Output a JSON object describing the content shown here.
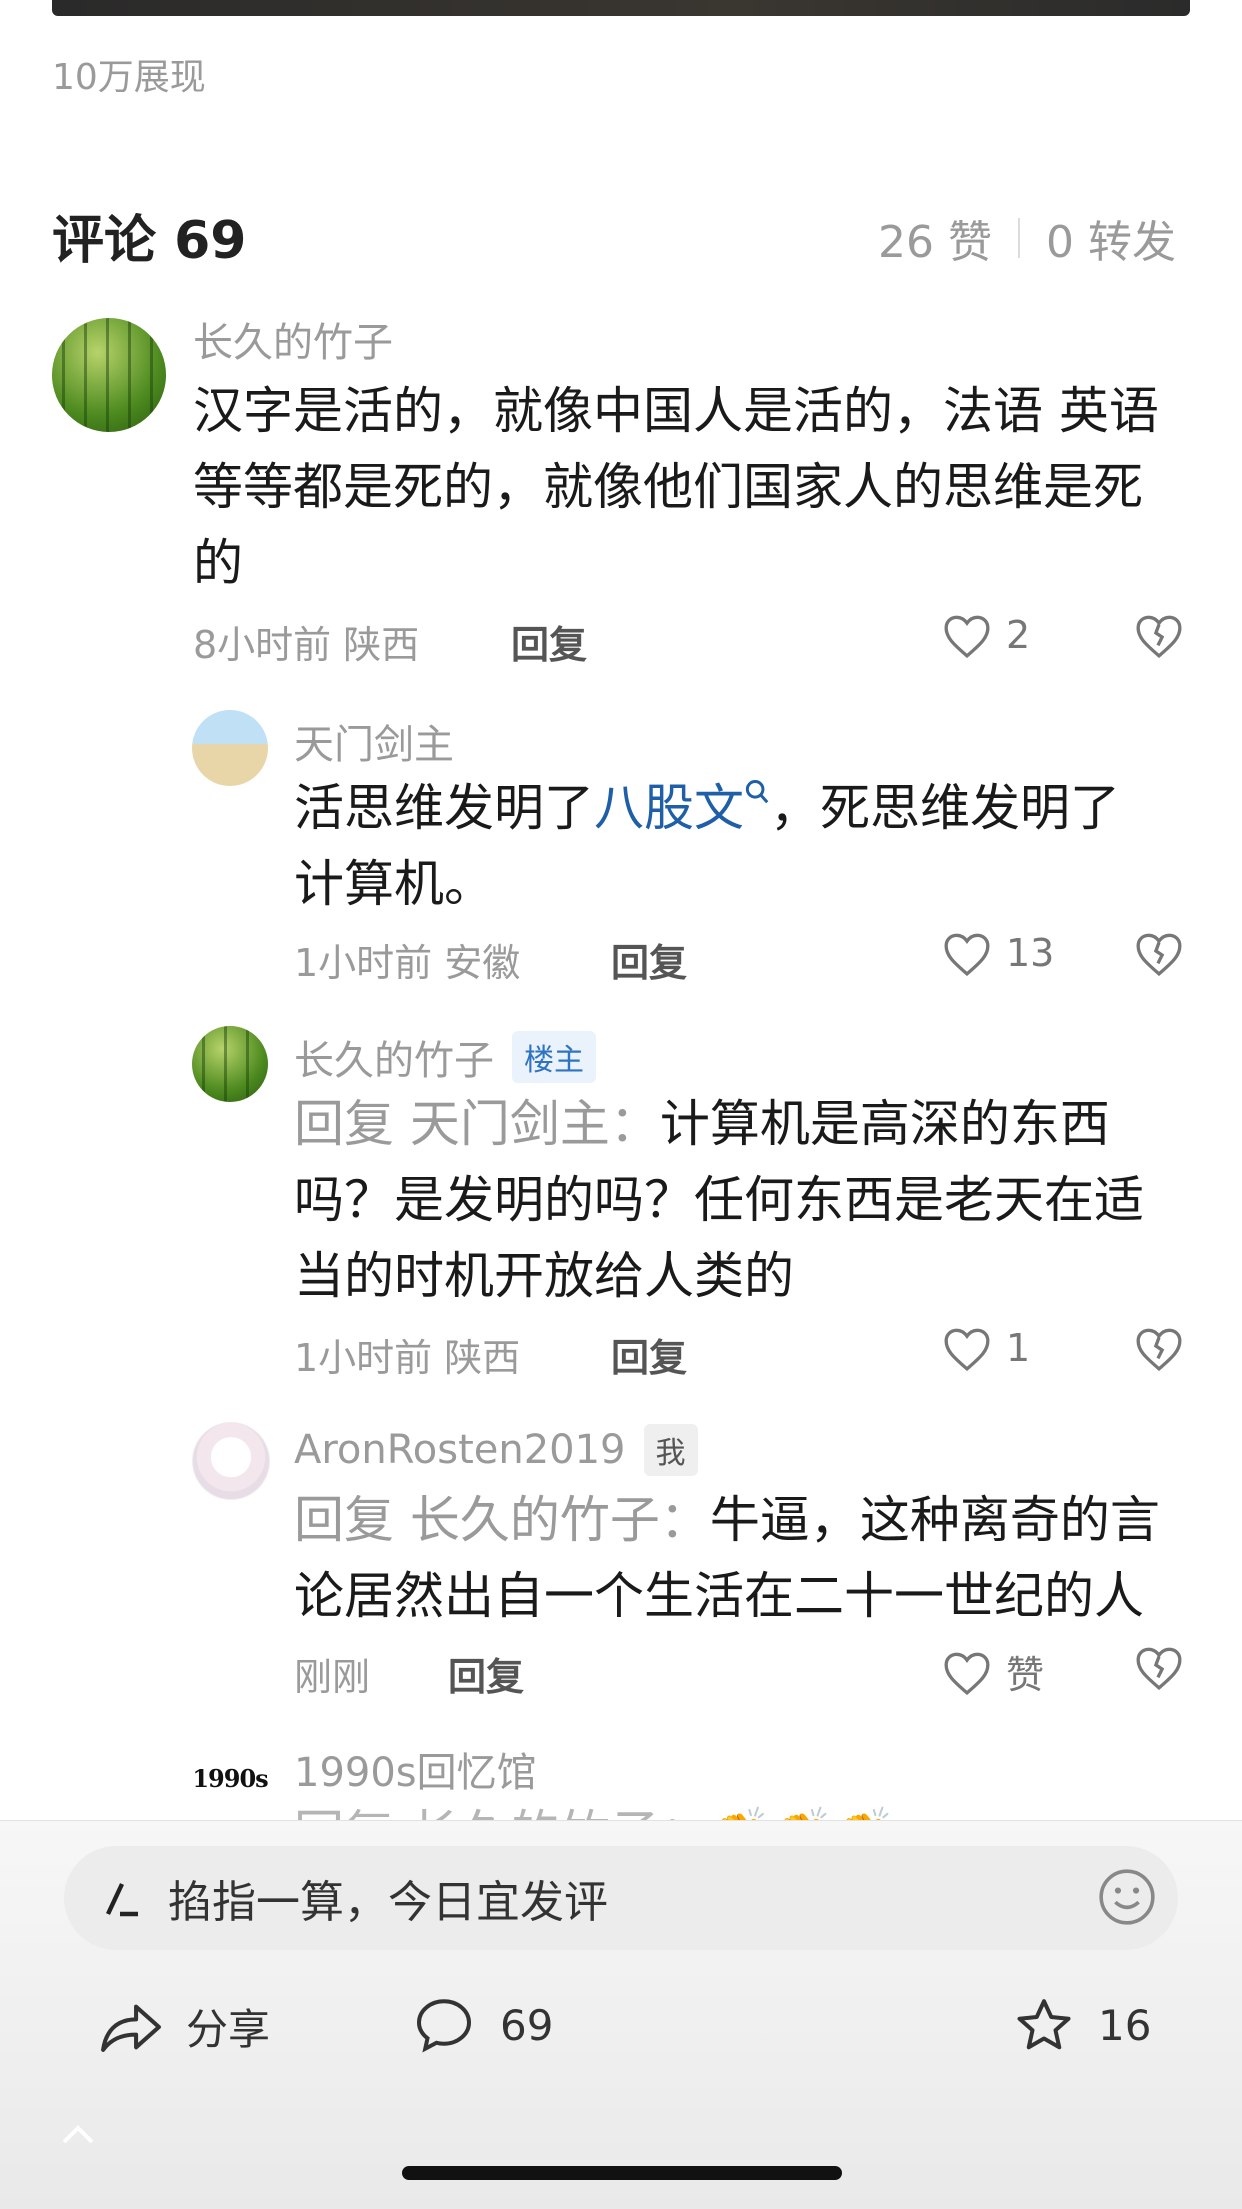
{
  "post": {
    "impressions": "10万展现"
  },
  "comments_header": {
    "title": "评论 69",
    "likes": "26 赞",
    "reposts": "0 转发"
  },
  "comments": [
    {
      "user": "长久的竹子",
      "text": "汉字是活的，就像中国人是活的，法语 英语等等都是死的，就像他们国家人的思维是死的",
      "line1": "汉字是活的，就像中国人是活的，法语 英语",
      "line2": "等等都是死的，就像他们国家人的思维是死",
      "line3": "的",
      "time_loc": "8小时前 陕西",
      "reply": "回复",
      "likes": "2"
    }
  ],
  "replies": [
    {
      "user": "天门剑主",
      "line1_pre": "活思维发明了",
      "line1_link": "八股文",
      "line1_post": "，死思维发明了",
      "line2": "计算机。",
      "time_loc": "1小时前 安徽",
      "reply": "回复",
      "likes": "13"
    },
    {
      "user": "长久的竹子",
      "badge": "楼主",
      "reply_to": "回复 天门剑主：",
      "line1": "计算机是高深的东西",
      "line2": "吗？是发明的吗？任何东西是老天在适",
      "line3": "当的时机开放给人类的",
      "time_loc": "1小时前 陕西",
      "reply": "回复",
      "likes": "1"
    },
    {
      "user": "AronRosten2019",
      "badge": "我",
      "reply_to": "回复 长久的竹子：",
      "line1": "牛逼，这种离奇的言",
      "line2": "论居然出自一个生活在二十一世纪的人",
      "time_loc": "刚刚",
      "reply": "回复",
      "likes": "赞"
    },
    {
      "user": "1990s回忆馆",
      "avatar_text": "1990s",
      "partial": "回复 长久的竹子：👏👏👏"
    }
  ],
  "input": {
    "placeholder": "掐指一算，今日宜发评"
  },
  "bottom_bar": {
    "share": "分享",
    "comments": "69",
    "favorites": "16"
  }
}
